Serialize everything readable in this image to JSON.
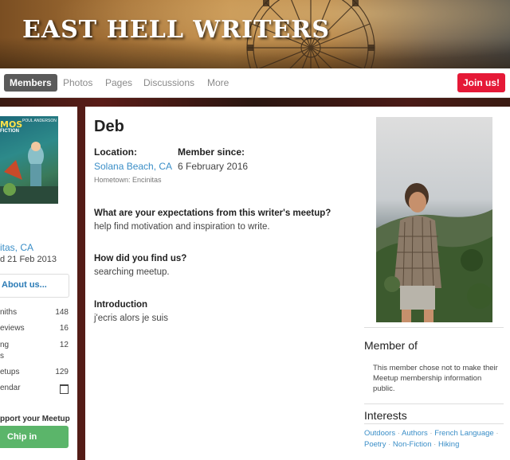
{
  "banner": {
    "title": "EAST HELL WRITERS"
  },
  "nav": {
    "tabs": [
      {
        "label": "Members",
        "active": true
      },
      {
        "label": "Photos",
        "active": false
      },
      {
        "label": "Pages",
        "active": false
      },
      {
        "label": "Discussions",
        "active": false
      },
      {
        "label": "More",
        "active": false
      }
    ],
    "join_label": "Join us!"
  },
  "sidebar": {
    "cover": {
      "brand": "MOS",
      "sub": "FICTION",
      "author": "POUL ANDERSON"
    },
    "location": "itas, CA",
    "founded": "d 21 Feb 2013",
    "about_label": "About us...",
    "stats": [
      {
        "label": "niths",
        "value": "148"
      },
      {
        "label": "eviews",
        "value": "16"
      },
      {
        "label": "ng",
        "value": "12"
      },
      {
        "label": "s",
        "value": ""
      },
      {
        "label": "etups",
        "value": "129"
      },
      {
        "label": "endar",
        "value": ""
      }
    ],
    "support_label": "pport your Meetup",
    "chip_label": "Chip in"
  },
  "profile": {
    "name": "Deb",
    "location_label": "Location:",
    "location_value": "Solana Beach, CA",
    "hometown": "Hometown: Encinitas",
    "member_since_label": "Member since:",
    "member_since_value": "6 February 2016",
    "qa": [
      {
        "q": "What are your expectations from this writer's meetup?",
        "a": "help find motivation and inspiration to write."
      },
      {
        "q": "How did you find us?",
        "a": "searching meetup."
      },
      {
        "q": "Introduction",
        "a": "j'ecris alors je suis"
      }
    ]
  },
  "side_panel": {
    "member_of_title": "Member of",
    "member_of_text": "This member chose not to make their Meetup membership information public.",
    "interests_title": "Interests",
    "interests": [
      "Outdoors",
      "Authors",
      "French Language",
      "Poetry",
      "Non-Fiction",
      "Hiking"
    ]
  },
  "colors": {
    "accent": "#e51937",
    "link": "#3a8ec7",
    "chip": "#5bb56a"
  }
}
